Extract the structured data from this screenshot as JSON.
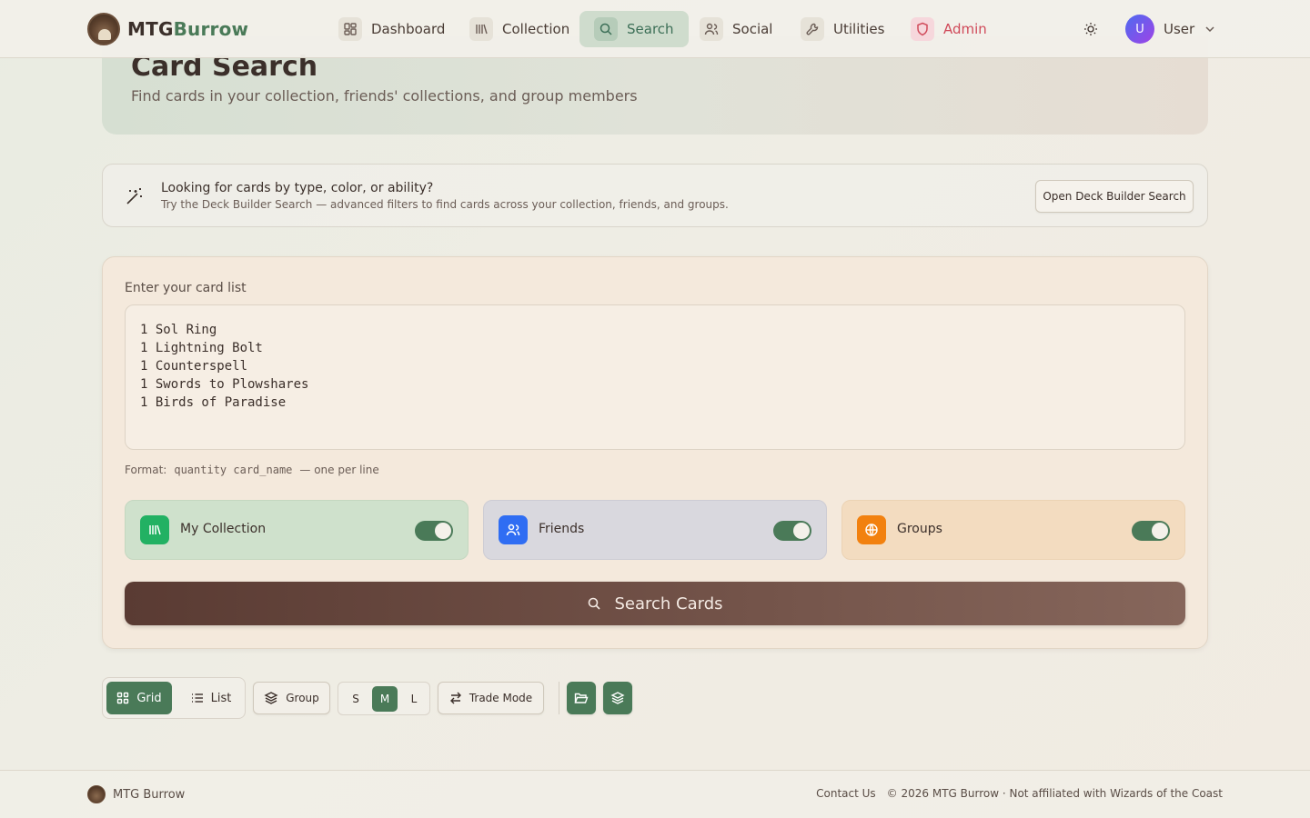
{
  "brand": {
    "name_a": "MTG",
    "name_b": "Burrow"
  },
  "nav": {
    "items": [
      {
        "label": "Dashboard"
      },
      {
        "label": "Collection"
      },
      {
        "label": "Search"
      },
      {
        "label": "Social"
      },
      {
        "label": "Utilities"
      },
      {
        "label": "Admin"
      }
    ],
    "active": "Search"
  },
  "user": {
    "initial": "U",
    "name": "User"
  },
  "hero": {
    "title": "Card Search",
    "subtitle": "Find cards in your collection, friends' collections, and group members"
  },
  "tip": {
    "title": "Looking for cards by type, color, or ability?",
    "desc": "Try the Deck Builder Search — advanced filters to find cards across your collection, friends, and groups.",
    "button": "Open Deck Builder Search"
  },
  "search_form": {
    "label": "Enter your card list",
    "card_list": "1 Sol Ring\n1 Lightning Bolt\n1 Counterspell\n1 Swords to Plowshares\n1 Birds of Paradise",
    "format_prefix": "Format:",
    "format_code": "quantity card_name",
    "format_suffix": "— one per line",
    "sources": [
      {
        "label": "My Collection",
        "enabled": true,
        "color": "#22b163"
      },
      {
        "label": "Friends",
        "enabled": true,
        "color": "#2f6df3"
      },
      {
        "label": "Groups",
        "enabled": true,
        "color": "#f2810f"
      }
    ],
    "submit": "Search Cards"
  },
  "toolbar": {
    "grid": "Grid",
    "list": "List",
    "group": "Group",
    "sizes": [
      "S",
      "M",
      "L"
    ],
    "size_selected": "M",
    "trade_mode": "Trade Mode"
  },
  "footer": {
    "brand": "MTG Burrow",
    "contact": "Contact Us",
    "copyright": "© 2026 MTG Burrow · Not affiliated with Wizards of the Coast"
  },
  "colors": {
    "accent": "#4a7a58",
    "admin": "#d04a5a",
    "primary_button": "#5a3b33"
  }
}
